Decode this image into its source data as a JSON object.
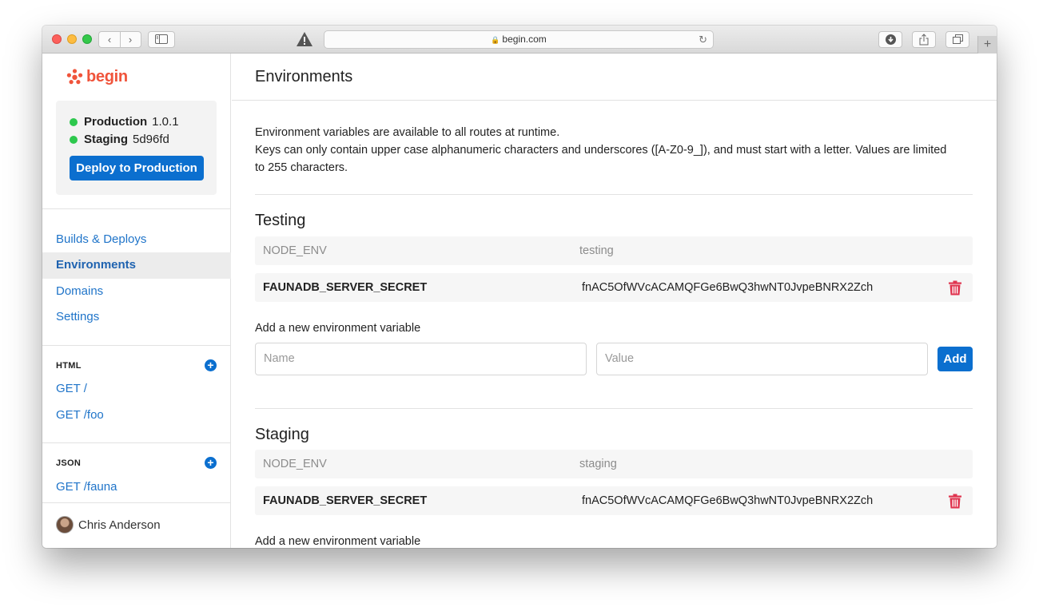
{
  "browser": {
    "url": "begin.com",
    "nav_back": "‹",
    "nav_forward": "›",
    "lock_icon": "lock-icon",
    "newtab": "+"
  },
  "sidebar": {
    "logo_text": "begin",
    "brand_color": "#f0543b",
    "status": {
      "production_label": "Production",
      "production_version": "1.0.1",
      "staging_label": "Staging",
      "staging_version": "5d96fd",
      "status_color": "#2dc84d"
    },
    "deploy_button": "Deploy to Production",
    "nav": [
      {
        "label": "Builds & Deploys"
      },
      {
        "label": "Environments",
        "active": true
      },
      {
        "label": "Domains"
      },
      {
        "label": "Settings"
      }
    ],
    "html_section": {
      "label": "HTML",
      "routes": [
        "GET /",
        "GET /foo"
      ]
    },
    "json_section": {
      "label": "JSON",
      "routes": [
        "GET /fauna"
      ]
    },
    "user_name": "Chris Anderson"
  },
  "main": {
    "title": "Environments",
    "intro_line1": "Environment variables are available to all routes at runtime.",
    "intro_line2": "Keys can only contain upper case alphanumeric characters and underscores ([A-Z0-9_]), and must start with a letter. Values are limited to 255 characters.",
    "environments": [
      {
        "name": "Testing",
        "variables": [
          {
            "key": "NODE_ENV",
            "value": "testing"
          },
          {
            "key": "FAUNADB_SERVER_SECRET",
            "value": "fnAC5OfWVcACAMQFGe6BwQ3hwNT0JvpeBNRX2Zch"
          }
        ],
        "add_label": "Add a new environment variable",
        "name_placeholder": "Name",
        "value_placeholder": "Value",
        "add_button": "Add"
      },
      {
        "name": "Staging",
        "variables": [
          {
            "key": "NODE_ENV",
            "value": "staging"
          },
          {
            "key": "FAUNADB_SERVER_SECRET",
            "value": "fnAC5OfWVcACAMQFGe6BwQ3hwNT0JvpeBNRX2Zch"
          }
        ],
        "add_label": "Add a new environment variable"
      }
    ],
    "accent_color": "#0b6fcf",
    "delete_color": "#e0344f"
  }
}
